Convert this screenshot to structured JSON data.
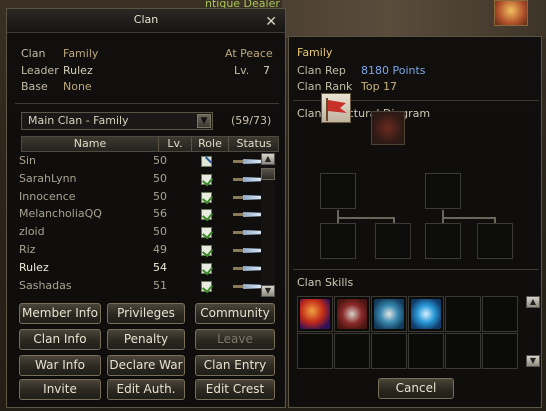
{
  "world": {
    "npc_tag": "ntique Dealer"
  },
  "clan_window": {
    "title": "Clan",
    "info": {
      "clan_label": "Clan",
      "clan_value": "Family",
      "leader_label": "Leader",
      "leader_value": "Rulez",
      "base_label": "Base",
      "base_value": "None",
      "war_status": "At Peace",
      "level_label": "Lv.",
      "level_value": "7"
    },
    "subclan_select": "Main Clan - Family",
    "member_count": "(59/73)",
    "columns": [
      "Name",
      "Lv.",
      "Role",
      "Status"
    ],
    "members": [
      {
        "name": "Sin",
        "lv": "50",
        "role": "edit"
      },
      {
        "name": "SarahLynn",
        "lv": "50",
        "role": "check"
      },
      {
        "name": "Innocence",
        "lv": "50",
        "role": "check"
      },
      {
        "name": "MelancholiaQQ",
        "lv": "56",
        "role": "check"
      },
      {
        "name": "zloid",
        "lv": "50",
        "role": "check"
      },
      {
        "name": "Riz",
        "lv": "49",
        "role": "check"
      },
      {
        "name": "Rulez",
        "lv": "54",
        "role": "check",
        "self": true
      },
      {
        "name": "Sashadas",
        "lv": "51",
        "role": "check"
      }
    ],
    "buttons": {
      "member_info": "Member Info",
      "privileges": "Privileges",
      "community": "Community",
      "clan_info": "Clan Info",
      "penalty": "Penalty",
      "leave": "Leave",
      "war_info": "War Info",
      "declare_war": "Declare War",
      "clan_entry": "Clan Entry",
      "invite": "Invite",
      "edit_auth": "Edit Auth.",
      "edit_crest": "Edit Crest"
    }
  },
  "clan_detail": {
    "name": "Family",
    "rep_label": "Clan Rep",
    "rep_value": "8180 Points",
    "rank_label": "Clan Rank",
    "rank_value": "Top 17",
    "diagram_title": "Clan Structural Diagram",
    "skills_title": "Clan Skills",
    "skills": [
      "fire-crest-skill-icon",
      "shield-skill-icon",
      "rune-skill-icon",
      "water-rune-skill-icon"
    ],
    "cancel": "Cancel"
  },
  "colors": {
    "accent_gold": "#e8c870",
    "rep_blue": "#7fa6e6",
    "rank_gold": "#c9b27e"
  }
}
